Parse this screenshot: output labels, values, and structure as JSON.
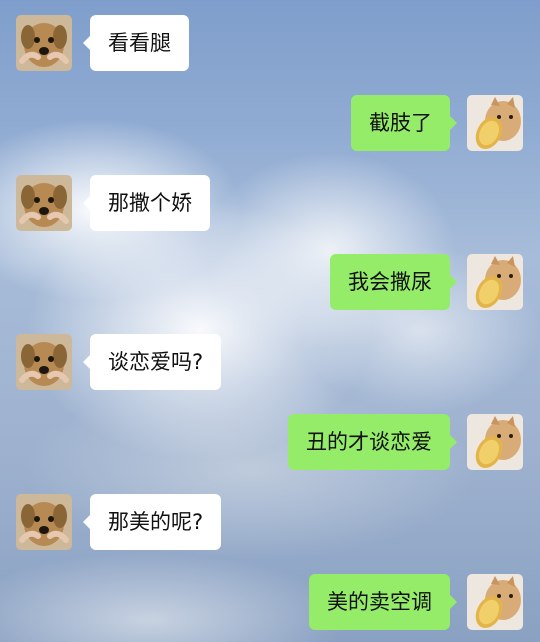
{
  "chat": {
    "messages": [
      {
        "side": "left",
        "text": "看看腿",
        "avatar_icon": "puppy-avatar-icon"
      },
      {
        "side": "right",
        "text": "截肢了",
        "avatar_icon": "cat-with-toast-avatar-icon"
      },
      {
        "side": "left",
        "text": "那撒个娇",
        "avatar_icon": "puppy-avatar-icon"
      },
      {
        "side": "right",
        "text": "我会撒尿",
        "avatar_icon": "cat-with-toast-avatar-icon"
      },
      {
        "side": "left",
        "text": "谈恋爱吗?",
        "avatar_icon": "puppy-avatar-icon"
      },
      {
        "side": "right",
        "text": "丑的才谈恋爱",
        "avatar_icon": "cat-with-toast-avatar-icon"
      },
      {
        "side": "left",
        "text": "那美的呢?",
        "avatar_icon": "puppy-avatar-icon"
      },
      {
        "side": "right",
        "text": "美的卖空调",
        "avatar_icon": "cat-with-toast-avatar-icon"
      }
    ]
  },
  "colors": {
    "incoming_bubble": "#ffffff",
    "outgoing_bubble": "#95ec69",
    "text": "#111111"
  }
}
